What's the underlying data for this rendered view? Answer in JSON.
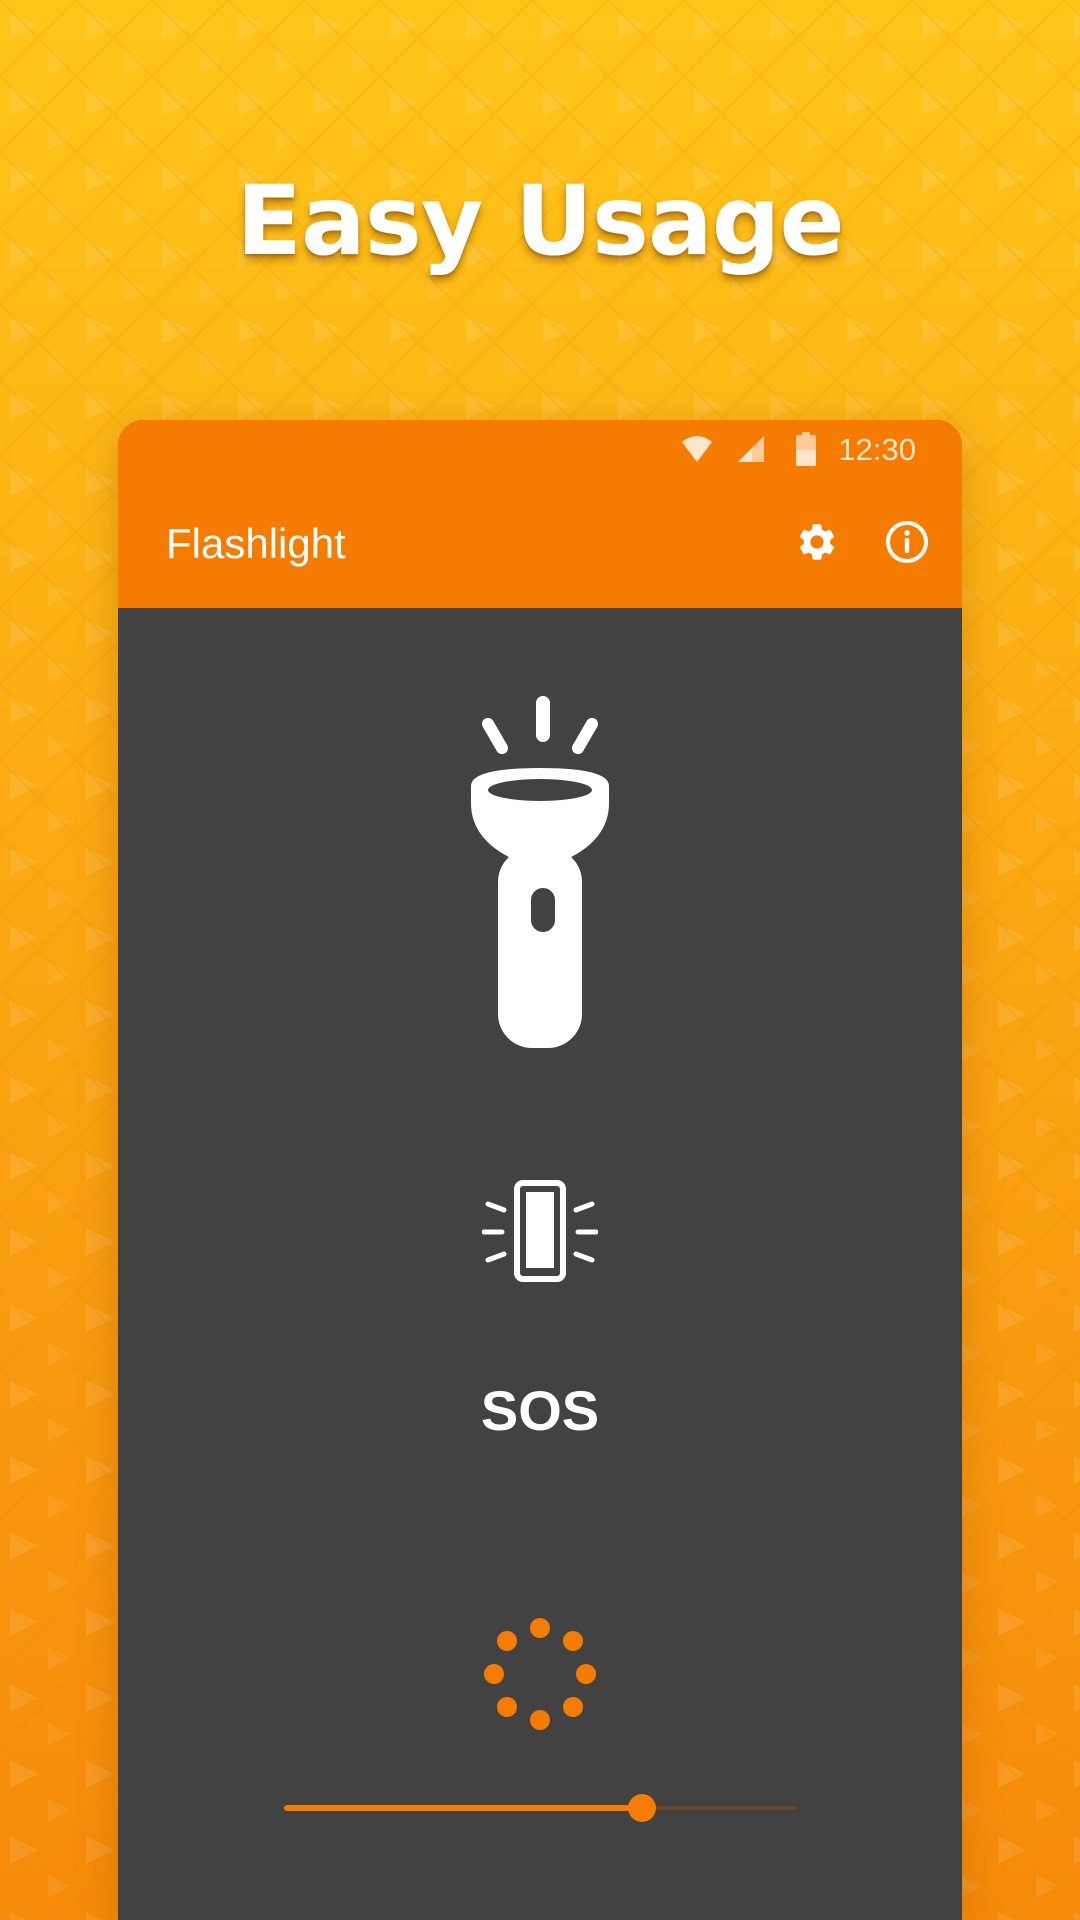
{
  "headline": "Easy Usage",
  "status_bar": {
    "time": "12:30"
  },
  "app_bar": {
    "title": "Flashlight"
  },
  "icons": {
    "settings": "gear-icon",
    "info": "info-icon",
    "flashlight": "flashlight-icon",
    "strobe": "phone-strobe-icon",
    "brightness": "brightness-dots-icon",
    "wifi": "wifi-icon",
    "signal": "signal-icon",
    "battery": "battery-icon"
  },
  "main": {
    "sos_label": "SOS",
    "brightness_slider_fraction": 0.7
  },
  "colors": {
    "accent": "#F57C00",
    "surface": "#424242",
    "background_top": "#FFC61A",
    "background_bottom": "#F68A0A"
  }
}
